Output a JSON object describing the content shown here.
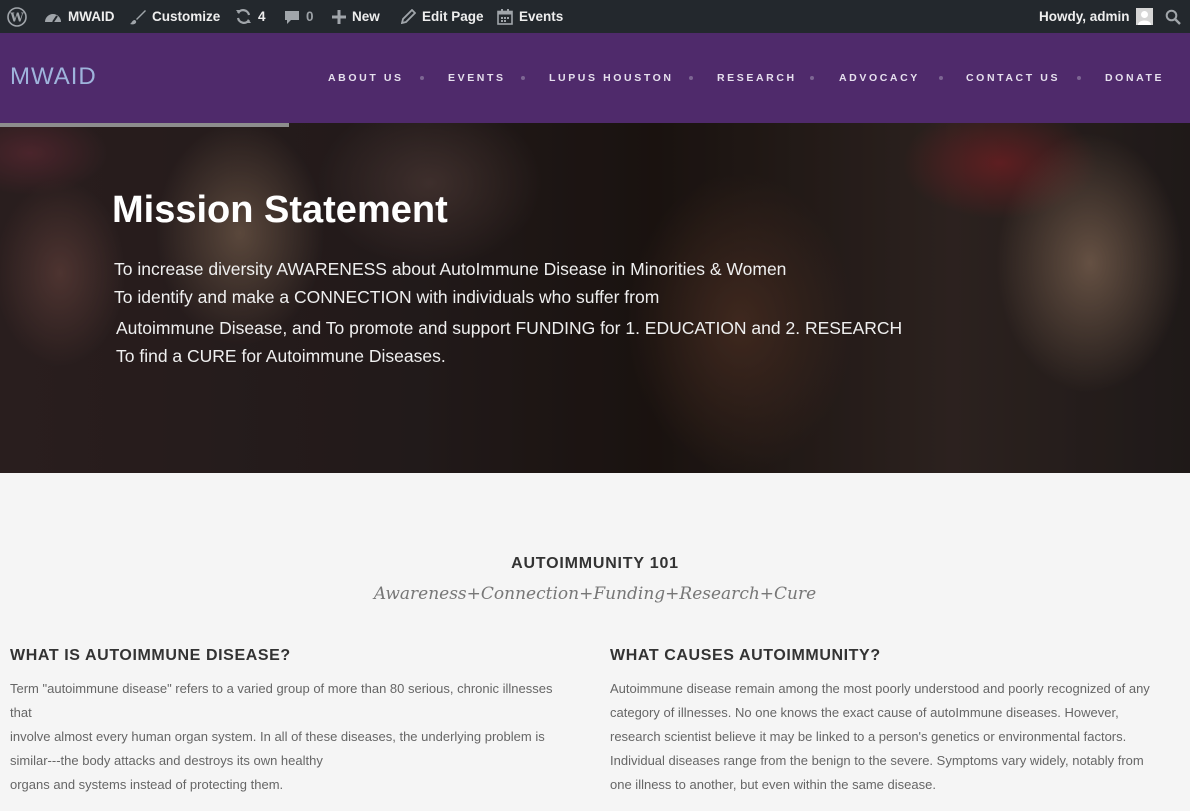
{
  "admin_bar": {
    "site_name": "MWAID",
    "customize": "Customize",
    "updates_count": "4",
    "comments_count": "0",
    "new_label": "New",
    "edit_page": "Edit Page",
    "events": "Events",
    "howdy": "Howdy, admin"
  },
  "header": {
    "logo": "MWAID",
    "nav": [
      "ABOUT US",
      "EVENTS",
      "LUPUS HOUSTON",
      "RESEARCH",
      "ADVOCACY",
      "CONTACT US",
      "DONATE"
    ]
  },
  "hero": {
    "title": "Mission Statement",
    "lines": [
      "To increase diversity AWARENESS about AutoImmune Disease in Minorities & Women",
      "To identify and make a CONNECTION with individuals who suffer from",
      "Autoimmune Disease, and To promote and support FUNDING for 1. EDUCATION and 2. RESEARCH",
      "To find a CURE for Autoimmune Diseases."
    ]
  },
  "section": {
    "title": "AUTOIMMUNITY 101",
    "tagline": "Awareness+Connection+Funding+Research+Cure"
  },
  "columns": [
    {
      "heading": "WHAT IS AUTOIMMUNE DISEASE?",
      "lines": [
        "Term \"autoimmune disease\" refers to a varied group of more than 80 serious, chronic illnesses",
        "that",
        "involve almost every human organ system. In all of these diseases, the underlying problem is",
        "similar---the body attacks and destroys its own healthy",
        "organs and systems instead of protecting them."
      ]
    },
    {
      "heading": "WHAT CAUSES AUTOIMMUNITY?",
      "lines": [
        "Autoimmune disease remain among the most poorly understood and poorly recognized of any",
        "category of illnesses. No one knows the exact cause of autoImmune diseases. However,",
        "research scientist believe it may be linked to a person's genetics or environmental factors.",
        "Individual diseases range from the benign to the severe. Symptoms vary widely, notably from",
        "one illness to another, but even within the same disease."
      ]
    }
  ]
}
